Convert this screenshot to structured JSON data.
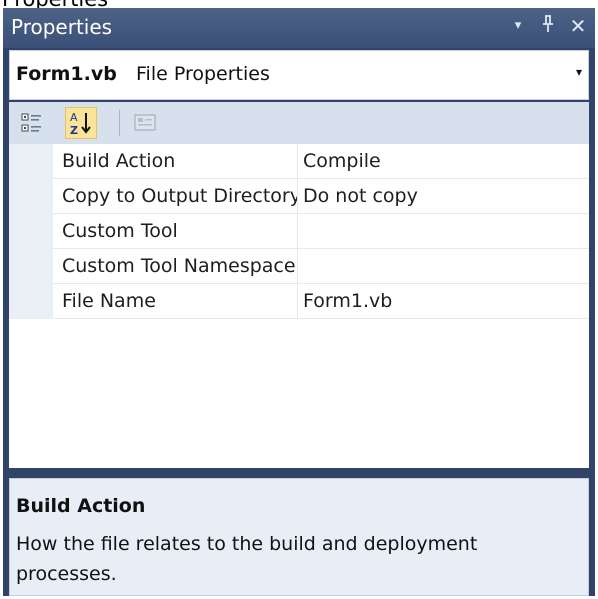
{
  "page": {
    "heading": "Properties"
  },
  "window": {
    "title": "Properties",
    "controls": {
      "dropdown_icon": "dropdown-arrow-icon",
      "pin_icon": "pin-icon",
      "close_icon": "close-icon"
    }
  },
  "object_selector": {
    "name": "Form1.vb",
    "type": "File Properties",
    "arrow": "▾"
  },
  "toolbar": {
    "buttons": [
      {
        "icon": "categorized-icon",
        "active": false
      },
      {
        "icon": "alphabetical-sort-icon",
        "active": true
      },
      {
        "icon": "property-pages-icon",
        "active": false
      }
    ]
  },
  "properties": [
    {
      "name": "Build Action",
      "value": "Compile"
    },
    {
      "name": "Copy to Output Directory",
      "value": "Do not copy"
    },
    {
      "name": "Custom Tool",
      "value": ""
    },
    {
      "name": "Custom Tool Namespace",
      "value": ""
    },
    {
      "name": "File Name",
      "value": "Form1.vb"
    }
  ],
  "help": {
    "title": "Build Action",
    "description": "How the file relates to the build and deployment processes."
  },
  "colors": {
    "title_bar": "#3d5279",
    "toolbar_bg": "#d7e0ed",
    "active_button": "#fbe39a",
    "gutter": "#eaeef5",
    "help_bg": "#e8eef6"
  }
}
